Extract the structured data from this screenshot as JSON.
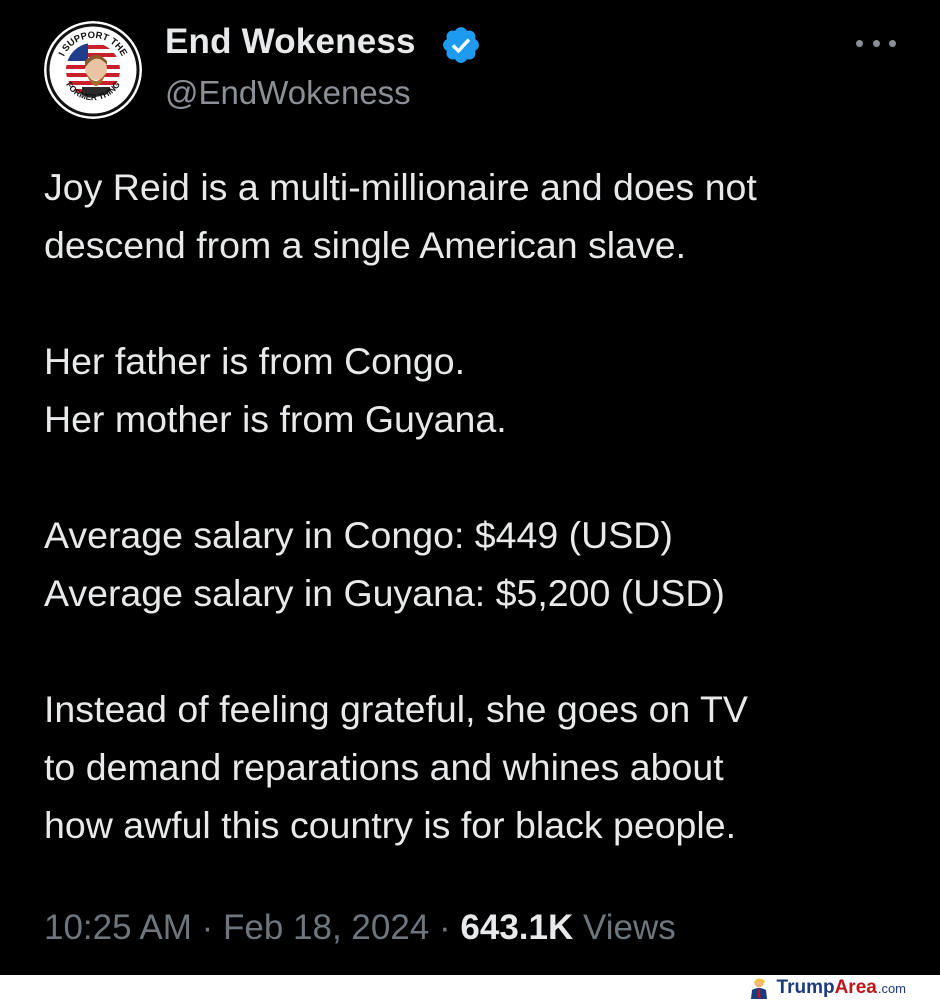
{
  "author": {
    "display_name": "End Wokeness",
    "handle": "@EndWokeness",
    "avatar_badge_text_top": "I SUPPORT THE",
    "avatar_badge_text_bottom": "FORMER THING"
  },
  "tweet": {
    "paragraphs": [
      [
        "Joy Reid is a multi-millionaire and does not",
        "descend from a single American slave."
      ],
      [
        "Her father is from Congo.",
        "Her mother is from Guyana."
      ],
      [
        "Average salary in Congo: $449 (USD)",
        "Average salary in Guyana: $5,200 (USD)"
      ],
      [
        "Instead of feeling grateful, she goes on TV",
        "to demand reparations and whines about",
        "how awful this country is for black people."
      ]
    ]
  },
  "meta": {
    "time": "10:25 AM",
    "separator": " · ",
    "date": "Feb 18, 2024",
    "views_count": "643.1K",
    "views_label": "Views"
  },
  "watermark": {
    "part1": "Trump",
    "part2": "Area",
    "part3": ".com"
  },
  "colors": {
    "background": "#000000",
    "text_primary": "#e7e9ea",
    "text_secondary": "#6e767d",
    "verified_blue": "#1d9bf0"
  }
}
